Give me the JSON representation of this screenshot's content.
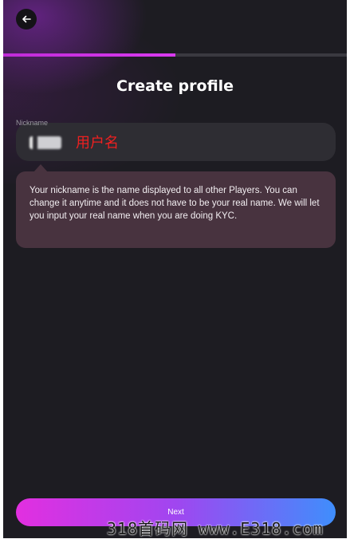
{
  "header": {
    "back_icon": "arrow-left-icon"
  },
  "progress": {
    "fraction": 0.5
  },
  "page": {
    "title": "Create profile"
  },
  "nickname_field": {
    "label": "Nickname",
    "annotation": "用户名"
  },
  "tooltip": {
    "text": "Your nickname is the name displayed to all other Players. You can change it anytime and it does not have to be your real name. We will let you input your real name when you are doing KYC."
  },
  "footer": {
    "next_label": "Next"
  },
  "watermark": {
    "text": "318首码网 www.E318.com"
  },
  "colors": {
    "background": "#1d1c22",
    "accent_magenta": "#e22fe0",
    "accent_blue": "#3f8efc",
    "tooltip_bg": "#48333f",
    "annotation_red": "#ee2020"
  }
}
